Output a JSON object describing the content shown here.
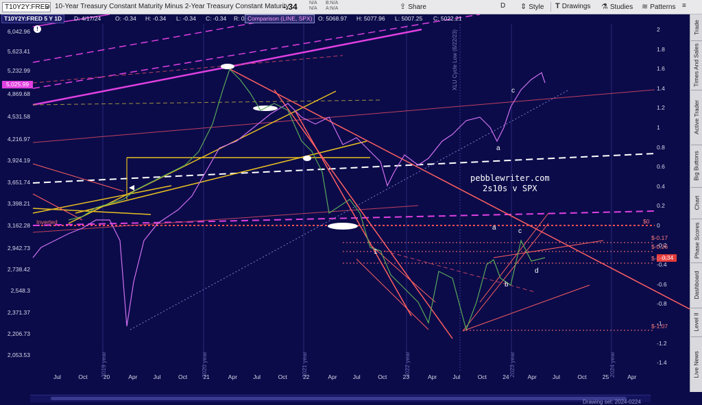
{
  "topbar": {
    "symbol": "T10Y2Y:FRED",
    "title": "10-Year Treasury Constant Maturity Minus 2-Year Treasury Constant Maturity",
    "last_value": "-.34",
    "na1": "N/A",
    "na2": "N/A",
    "na3": "N/A",
    "bid_label": "B:",
    "ask_label": "A:",
    "share_label": "Share",
    "interval_label": "D",
    "style_label": "Style",
    "drawings_label": "Drawings",
    "studies_label": "Studies",
    "patterns_label": "Patterns"
  },
  "info": {
    "symbol_period": "T10Y2Y:FRED 5 Y 1D",
    "date": "D: 4/17/24",
    "open": "O: -0.34",
    "high": "H: -0.34",
    "low": "L: -0.34",
    "close": "C: -0.34",
    "r": "R: 0",
    "comparison": "Comparison (LINE, SPX)",
    "comp_open": "O: 5068.97",
    "comp_high": "H: 5077.96",
    "comp_low": "L: 5007.25",
    "comp_close": "C: 5022.21"
  },
  "left_axis": [
    "6,042.96",
    "5,623.41",
    "5,232.99",
    "4,869.68",
    "4,531.58",
    "4,216.97",
    "3,924.19",
    "3,651.74",
    "3,398.21",
    "3,162.28",
    "2,942.73",
    "2,738.42",
    "2,548.3",
    "2,371.37",
    "2,206.73",
    "2,053.53"
  ],
  "spx_last_badge": "5,025.99",
  "right_axis": [
    "2",
    "1.8",
    "1.6",
    "1.4",
    "1.2",
    "1",
    "0.8",
    "0.6",
    "0.4",
    "0.2",
    "0",
    "-0.2",
    "-0.4",
    "-0.6",
    "-0.8",
    "-1",
    "-1.2",
    "-1.4"
  ],
  "last_badge": "-0.34",
  "x_axis": [
    "Jul",
    "Oct",
    "20",
    "Apr",
    "Jul",
    "Oct",
    "21",
    "Apr",
    "Jul",
    "Oct",
    "22",
    "Apr",
    "Jul",
    "Oct",
    "23",
    "Apr",
    "Jul",
    "Oct",
    "24",
    "Apr",
    "Jul",
    "Oct",
    "25",
    "Apr"
  ],
  "year_labels": [
    "2019 year",
    "2020 year",
    "2021 year",
    "2022 year",
    "2023 year",
    "2024 year"
  ],
  "levels": [
    "$0",
    "$-0.17",
    "$-0.26",
    "$-0.38",
    "$-1.07"
  ],
  "inverted_label": "Inverted",
  "xlu_label": "XLU Cycle Low (6/22/23)",
  "watermark": {
    "line1": "pebblewriter.com",
    "line2": "2s10s v SPX"
  },
  "annotations": {
    "upper_c": "c",
    "upper_a": "a",
    "lower_a": "a",
    "lower_c": "c",
    "lower_b": "b",
    "lower_d": "d",
    "wave_1": "1"
  },
  "sidebar": [
    "Trade",
    "Times And Sales",
    "Active Trader",
    "Big Buttons",
    "Chart",
    "Phase Scores",
    "Dashboard",
    "Level II",
    "Live News"
  ],
  "status": "Drawing set: 2024-0224",
  "colors": {
    "background": "#0b0b4a",
    "spx_line": "#d070f0",
    "yield_up": "#5aa85a",
    "yield_down": "#b05050",
    "trend_pink": "#ff6060",
    "trend_yellow": "#e8c020",
    "trend_magenta": "#e040e0"
  }
}
